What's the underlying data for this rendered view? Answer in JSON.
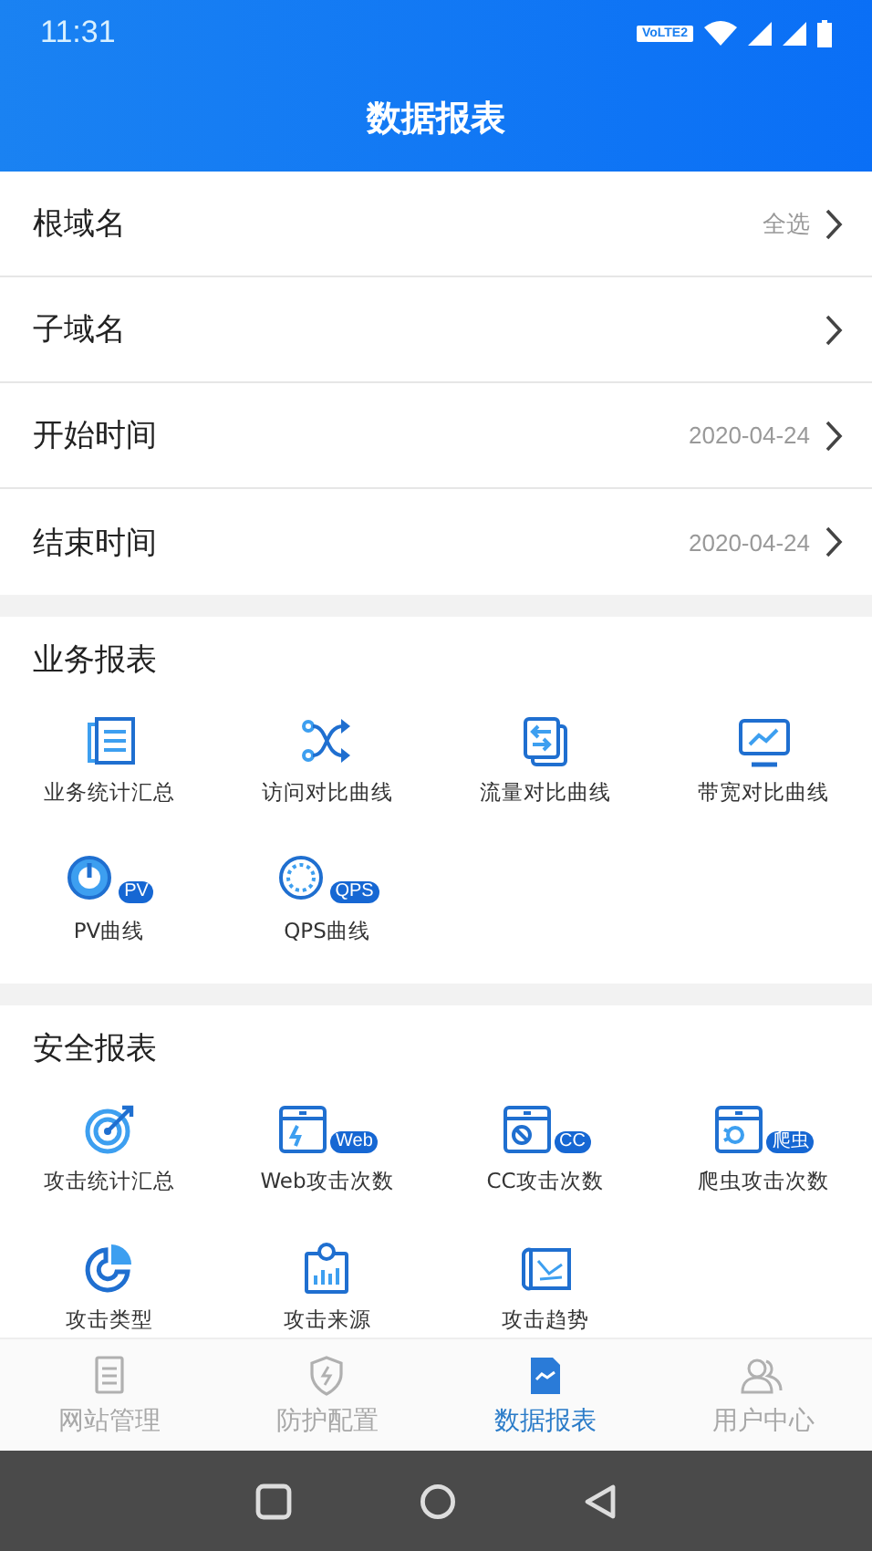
{
  "status_bar": {
    "time": "11:31",
    "network_badge": "VoLTE2"
  },
  "header": {
    "title": "数据报表"
  },
  "filters": [
    {
      "label": "根域名",
      "value": "全选"
    },
    {
      "label": "子域名"
    },
    {
      "label": "开始时间",
      "value": "2020-04-24"
    },
    {
      "label": "结束时间",
      "value": "2020-04-24"
    }
  ],
  "sections": [
    {
      "title": "业务报表",
      "items": [
        {
          "label": "业务统计汇总"
        },
        {
          "label": "访问对比曲线"
        },
        {
          "label": "流量对比曲线"
        },
        {
          "label": "带宽对比曲线"
        },
        {
          "label": "PV曲线",
          "badge": "PV"
        },
        {
          "label": "QPS曲线",
          "badge": "QPS"
        }
      ]
    },
    {
      "title": "安全报表",
      "items": [
        {
          "label": "攻击统计汇总"
        },
        {
          "label": "Web攻击次数",
          "badge": "Web"
        },
        {
          "label": "CC攻击次数",
          "badge": "CC"
        },
        {
          "label": "爬虫攻击次数",
          "badge": "爬虫"
        },
        {
          "label": "攻击类型"
        },
        {
          "label": "攻击来源"
        },
        {
          "label": "攻击趋势"
        }
      ]
    }
  ],
  "tab_bar": [
    {
      "label": "网站管理",
      "selected": false
    },
    {
      "label": "防护配置",
      "selected": false
    },
    {
      "label": "数据报表",
      "selected": true
    },
    {
      "label": "用户中心",
      "selected": false
    }
  ]
}
